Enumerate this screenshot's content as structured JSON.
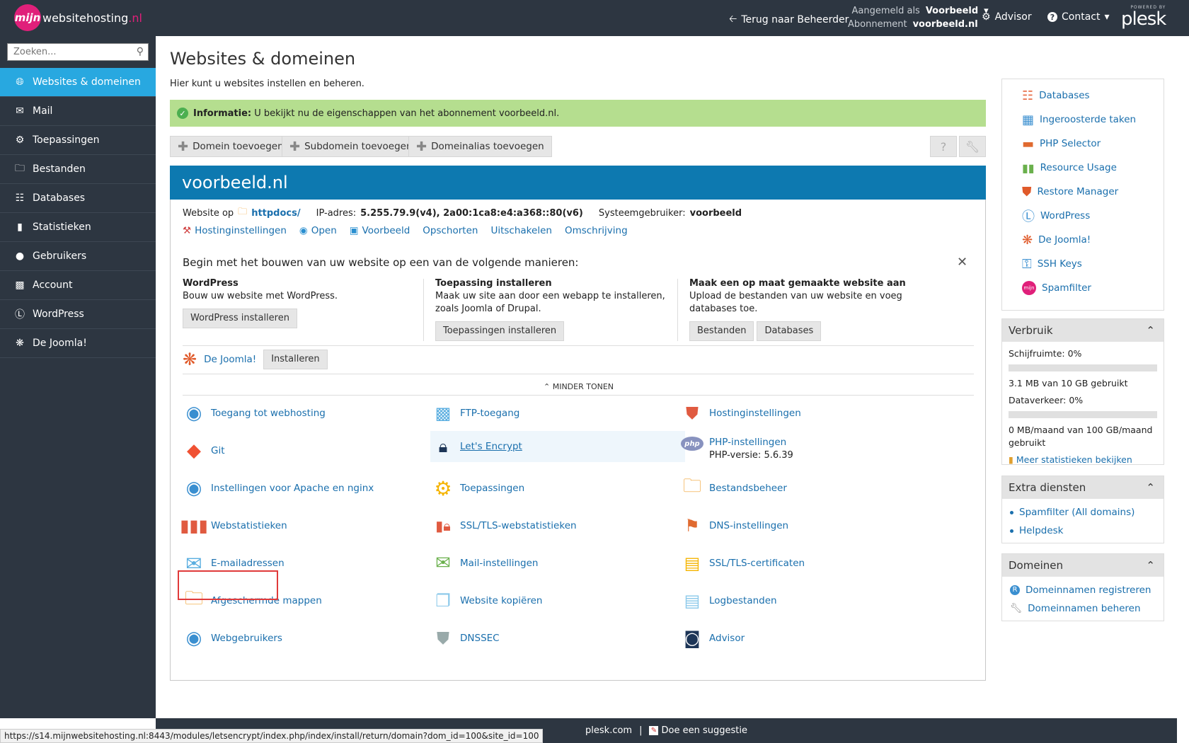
{
  "header": {
    "logo_circle": "mijn",
    "brand_main": "websitehosting",
    "brand_tld": ".nl",
    "back_label": "Terug naar Beheerder",
    "logged_in_key": "Aangemeld als",
    "logged_in_value": "Voorbeeld",
    "subscription_key": "Abonnement",
    "subscription_value": "voorbeeld.nl",
    "advisor_label": "Advisor",
    "contact_label": "Contact",
    "powered_by": "POWERED BY",
    "plesk": "plesk"
  },
  "sidebar": {
    "search_placeholder": "Zoeken...",
    "items": [
      {
        "label": "Websites & domeinen",
        "icon": "globe-icon",
        "active": true
      },
      {
        "label": "Mail",
        "icon": "envelope-icon"
      },
      {
        "label": "Toepassingen",
        "icon": "gear-icon"
      },
      {
        "label": "Bestanden",
        "icon": "folder-icon"
      },
      {
        "label": "Databases",
        "icon": "database-icon"
      },
      {
        "label": "Statistieken",
        "icon": "bar-chart-icon"
      },
      {
        "label": "Gebruikers",
        "icon": "user-icon"
      },
      {
        "label": "Account",
        "icon": "id-card-icon"
      },
      {
        "label": "WordPress",
        "icon": "wordpress-icon"
      },
      {
        "label": "De Joomla!",
        "icon": "joomla-icon"
      }
    ]
  },
  "main": {
    "title": "Websites & domeinen",
    "description": "Hier kunt u websites instellen en beheren.",
    "info_label": "Informatie:",
    "info_text": "U bekijkt nu de eigenschappen van het abonnement voorbeeld.nl.",
    "toolbar": [
      "Domein toevoegen",
      "Subdomein toevoegen",
      "Domeinalias toevoegen"
    ],
    "domain": {
      "name": "voorbeeld.nl",
      "website_op": "Website op",
      "docroot": "httpdocs/",
      "ip_label": "IP-adres:",
      "ip_value": "5.255.79.9(v4), 2a00:1ca8:e4:a368::80(v6)",
      "sysuser_label": "Systeemgebruiker:",
      "sysuser_value": "voorbeeld",
      "quicklinks": [
        "Hostinginstellingen",
        "Open",
        "Voorbeeld",
        "Opschorten",
        "Uitschakelen",
        "Omschrijving"
      ]
    },
    "begin": {
      "heading": "Begin met het bouwen van uw website op een van de volgende manieren:",
      "columns": [
        {
          "title": "WordPress",
          "text": "Bouw uw website met WordPress.",
          "buttons": [
            "WordPress installeren"
          ]
        },
        {
          "title": "Toepassing installeren",
          "text": "Maak uw site aan door een webapp te installeren, zoals Joomla of Drupal.",
          "buttons": [
            "Toepassingen installeren"
          ]
        },
        {
          "title": "Maak een op maat gemaakte website aan",
          "text": "Upload de bestanden van uw website en voeg databases toe.",
          "buttons": [
            "Bestanden",
            "Databases"
          ]
        }
      ],
      "joomla_label": "De Joomla!",
      "joomla_button": "Installeren",
      "less_label": "MINDER TONEN"
    },
    "features": [
      {
        "label": "Toegang tot webhosting",
        "icon": "webhosting-access-icon"
      },
      {
        "label": "FTP-toegang",
        "icon": "ftp-icon"
      },
      {
        "label": "Hostinginstellingen",
        "icon": "hosting-settings-icon"
      },
      {
        "label": "Git",
        "icon": "git-icon"
      },
      {
        "label": "Let's Encrypt",
        "icon": "lets-encrypt-icon"
      },
      {
        "label": "PHP-instellingen",
        "icon": "php-icon",
        "sub": "PHP-versie: 5.6.39"
      },
      {
        "label": "Instellingen voor Apache en nginx",
        "icon": "apache-icon"
      },
      {
        "label": "Toepassingen",
        "icon": "applications-icon"
      },
      {
        "label": "Bestandsbeheer",
        "icon": "file-manager-icon"
      },
      {
        "label": "Webstatistieken",
        "icon": "web-stats-icon"
      },
      {
        "label": "SSL/TLS-webstatistieken",
        "icon": "ssl-stats-icon"
      },
      {
        "label": "DNS-instellingen",
        "icon": "dns-icon"
      },
      {
        "label": "E-mailadressen",
        "icon": "email-addresses-icon"
      },
      {
        "label": "Mail-instellingen",
        "icon": "mail-settings-icon"
      },
      {
        "label": "SSL/TLS-certificaten",
        "icon": "certificate-icon"
      },
      {
        "label": "Afgeschermde mappen",
        "icon": "protected-folder-icon"
      },
      {
        "label": "Website kopiëren",
        "icon": "copy-website-icon"
      },
      {
        "label": "Logbestanden",
        "icon": "log-files-icon"
      },
      {
        "label": "Webgebruikers",
        "icon": "web-users-icon"
      },
      {
        "label": "DNSSEC",
        "icon": "dnssec-icon"
      },
      {
        "label": "Advisor",
        "icon": "advisor-owl-icon"
      }
    ]
  },
  "right": {
    "links": [
      "Databases",
      "Ingeroosterde taken",
      "PHP Selector",
      "Resource Usage",
      "Restore Manager",
      "WordPress",
      "De Joomla!",
      "SSH Keys",
      "Spamfilter"
    ],
    "usage": {
      "title": "Verbruik",
      "disk_label": "Schijfruimte: 0%",
      "disk_fraction": 0,
      "disk_text": "3.1 MB van 10 GB gebruikt",
      "traffic_label": "Dataverkeer: 0%",
      "traffic_fraction": 0,
      "traffic_text": "0 MB/maand van 100 GB/maand gebruikt",
      "more_link": "Meer statistieken bekijken"
    },
    "extra": {
      "title": "Extra diensten",
      "items": [
        "Spamfilter (All domains)",
        "Helpdesk"
      ]
    },
    "domains": {
      "title": "Domeinen",
      "items": [
        "Domeinnamen registreren",
        "Domeinnamen beheren"
      ]
    }
  },
  "footer": {
    "left": "plesk.com",
    "sep": "|",
    "right": "Doe een suggestie",
    "status_url": "https://s14.mijnwebsitehosting.nl:8443/modules/letsencrypt/index.php/index/install/return/domain?dom_id=100&site_id=100"
  },
  "colors": {
    "header_bg": "#2d3641",
    "active_nav": "#28a8e0",
    "domain_header": "#0d79b0",
    "info_bg": "#b5de8f",
    "brand": "#e0207a",
    "highlight_border": "#e03a3a"
  }
}
